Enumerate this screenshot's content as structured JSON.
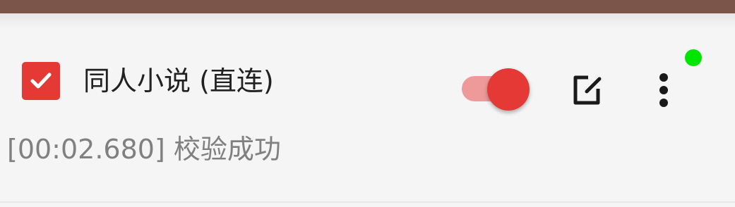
{
  "source_item": {
    "enabled": true,
    "name": "同人小说 (直连)",
    "switch_on": true,
    "log": "[00:02.680] 校验成功",
    "status": "online"
  },
  "icons": {
    "checkbox": "checkbox-checked-icon",
    "edit": "edit-icon",
    "more": "more-vert-icon",
    "status": "status-dot-icon"
  },
  "colors": {
    "accent": "#e53935",
    "accent_light": "#ef9a9a",
    "header": "#7b5549",
    "status_online": "#00e600",
    "text_primary": "#212121",
    "text_secondary": "#808080"
  }
}
